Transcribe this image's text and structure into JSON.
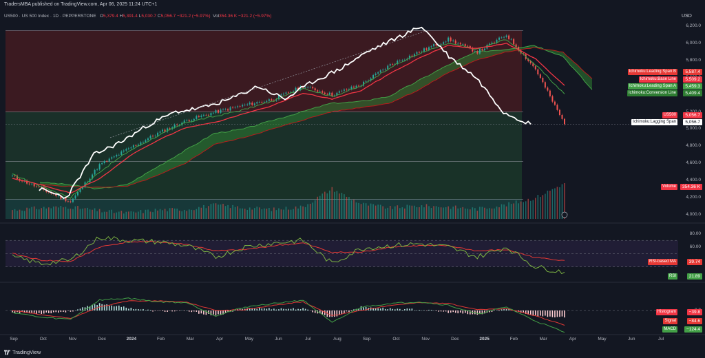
{
  "header": {
    "published": "TradersMBA published on TradingView.com, Apr 06, 2025 11:24 UTC+1",
    "currency": "USD",
    "symbol": "US500 · US 500 Index · 1D · PEPPERSTONE",
    "open_label": "O",
    "open": "5,379.4",
    "high_label": "H",
    "high": "5,391.4",
    "low_label": "L",
    "low": "5,030.7",
    "close_label": "C",
    "close": "5,056.7",
    "change": "−321.2 (−5.97%)",
    "vol_label": "Vol",
    "vol": "354.36 K",
    "vol_change": "−321.2 (−5.97%)"
  },
  "colors": {
    "background": "#131722",
    "up": "#26a69a",
    "down": "#ef5350",
    "lagging": "#ffffff",
    "base": "#f23645",
    "conversion": "#43a047",
    "rsi": "#7cb342",
    "rsi_ma": "#e53935"
  },
  "price_axis": [
    "6,200.0",
    "6,000.0",
    "5,800.0",
    "5,600.0",
    "5,400.0",
    "5,200.0",
    "5,000.0",
    "4,800.0",
    "4,600.0",
    "4,400.0",
    "4,200.0",
    "4,000.0"
  ],
  "rsi_axis": [
    "80.00",
    "60.00"
  ],
  "macd_axis": [
    "0.0"
  ],
  "time_axis": [
    {
      "label": "Sep",
      "bold": false
    },
    {
      "label": "Oct",
      "bold": false
    },
    {
      "label": "Nov",
      "bold": false
    },
    {
      "label": "Dec",
      "bold": false
    },
    {
      "label": "2024",
      "bold": true
    },
    {
      "label": "Feb",
      "bold": false
    },
    {
      "label": "Mar",
      "bold": false
    },
    {
      "label": "Apr",
      "bold": false
    },
    {
      "label": "May",
      "bold": false
    },
    {
      "label": "Jun",
      "bold": false
    },
    {
      "label": "Jul",
      "bold": false
    },
    {
      "label": "Aug",
      "bold": false
    },
    {
      "label": "Sep",
      "bold": false
    },
    {
      "label": "Oct",
      "bold": false
    },
    {
      "label": "Nov",
      "bold": false
    },
    {
      "label": "Dec",
      "bold": false
    },
    {
      "label": "2025",
      "bold": true
    },
    {
      "label": "Feb",
      "bold": false
    },
    {
      "label": "Mar",
      "bold": false
    },
    {
      "label": "Apr",
      "bold": false
    },
    {
      "label": "May",
      "bold": false
    },
    {
      "label": "Jun",
      "bold": false
    },
    {
      "label": "Jul",
      "bold": false
    }
  ],
  "tags": {
    "span_b": {
      "name": "Ichimoku:Leading Span B",
      "value": "5,587.4"
    },
    "base": {
      "name": "Ichimoku:Base Line",
      "value": "5,509.2"
    },
    "span_a": {
      "name": "Ichimoku:Leading Span A",
      "value": "5,459.3"
    },
    "conversion": {
      "name": "Ichimoku:Conversion Line",
      "value": "5,409.4"
    },
    "symbol": {
      "name": "US500",
      "value": "5,056.7"
    },
    "lagging": {
      "name": "Ichimoku:Lagging Span",
      "value": "5,056.7"
    },
    "volume": {
      "name": "Volume",
      "value": "354.36 K"
    },
    "rsi_ma": {
      "name": "RSI-based MA",
      "value": "39.74"
    },
    "rsi": {
      "name": "RSI",
      "value": "21.89"
    },
    "histogram": {
      "name": "Histogram",
      "value": "−39.8"
    },
    "signal": {
      "name": "Signal",
      "value": "−84.6"
    },
    "macd": {
      "name": "MACD",
      "value": "−124.4"
    }
  },
  "footer": {
    "brand": "TradingView"
  },
  "chart_data": [
    {
      "type": "line",
      "title": "US500 · US 500 Index · 1D · PEPPERSTONE",
      "xlabel": "",
      "ylabel": "USD",
      "ylim": [
        3950,
        6250
      ],
      "x": [
        "Sep",
        "Oct",
        "Nov",
        "Dec",
        "2024",
        "Feb",
        "Mar",
        "Apr",
        "May",
        "Jun",
        "Jul",
        "Aug",
        "Sep",
        "Oct",
        "Nov",
        "Dec",
        "2025",
        "Feb",
        "Mar",
        "Apr"
      ],
      "series": [
        {
          "name": "US500",
          "values": [
            4450,
            4300,
            4150,
            4580,
            4770,
            4950,
            5100,
            5200,
            5280,
            5350,
            5500,
            5400,
            5520,
            5750,
            5900,
            6050,
            5900,
            6100,
            5700,
            5056.7
          ]
        },
        {
          "name": "Ichimoku:Conversion Line",
          "values": [
            4470,
            4330,
            4200,
            4500,
            4740,
            4920,
            5080,
            5150,
            5230,
            5330,
            5480,
            5380,
            5500,
            5720,
            5880,
            6000,
            5930,
            6050,
            5750,
            5409.4
          ]
        },
        {
          "name": "Ichimoku:Base Line",
          "values": [
            4420,
            4350,
            4250,
            4420,
            4680,
            4870,
            5020,
            5080,
            5180,
            5280,
            5420,
            5350,
            5450,
            5650,
            5830,
            5980,
            5940,
            6000,
            5820,
            5509.2
          ]
        },
        {
          "name": "Ichimoku:Leading Span A",
          "values": [
            4380,
            4350,
            4300,
            4350,
            4550,
            4750,
            4950,
            5000,
            5100,
            5200,
            5300,
            5320,
            5380,
            5560,
            5740,
            5900,
            5930,
            5980,
            5850,
            5459.3
          ]
        },
        {
          "name": "Ichimoku:Leading Span B",
          "values": [
            4350,
            4330,
            4320,
            4330,
            4450,
            4600,
            4820,
            4900,
            5000,
            5100,
            5200,
            5250,
            5300,
            5450,
            5650,
            5800,
            5900,
            5950,
            5900,
            5587.4
          ]
        },
        {
          "name": "Ichimoku:Lagging Span",
          "values": [
            4300,
            4200,
            4700,
            4850,
            5050,
            5200,
            5250,
            5350,
            5500,
            5350,
            5550,
            5700,
            5900,
            6050,
            6200,
            5850,
            5600,
            5200,
            5056.7
          ]
        }
      ]
    },
    {
      "type": "bar",
      "title": "Volume",
      "categories": [
        "Sep",
        "Oct",
        "Nov",
        "Dec",
        "2024",
        "Feb",
        "Mar",
        "Apr",
        "May",
        "Jun",
        "Jul",
        "Aug",
        "Sep",
        "Oct",
        "Nov",
        "Dec",
        "2025",
        "Feb",
        "Mar",
        "Apr"
      ],
      "values": [
        90,
        110,
        120,
        80,
        60,
        90,
        95,
        140,
        110,
        95,
        120,
        300,
        150,
        110,
        130,
        120,
        100,
        140,
        210,
        354.36
      ]
    },
    {
      "type": "line",
      "title": "RSI",
      "ylim": [
        15,
        90
      ],
      "x": [
        "Sep",
        "Oct",
        "Nov",
        "Dec",
        "2024",
        "Feb",
        "Mar",
        "Apr",
        "May",
        "Jun",
        "Jul",
        "Aug",
        "Sep",
        "Oct",
        "Nov",
        "Dec",
        "2025",
        "Feb",
        "Mar",
        "Apr"
      ],
      "series": [
        {
          "name": "RSI",
          "values": [
            45,
            35,
            40,
            75,
            70,
            68,
            62,
            45,
            60,
            66,
            70,
            35,
            58,
            62,
            65,
            60,
            45,
            60,
            30,
            21.89
          ]
        },
        {
          "name": "RSI-based MA",
          "values": [
            50,
            40,
            38,
            60,
            68,
            68,
            64,
            54,
            56,
            62,
            66,
            52,
            52,
            60,
            62,
            62,
            54,
            56,
            44,
            39.74
          ]
        }
      ]
    },
    {
      "type": "line",
      "title": "MACD",
      "x": [
        "Sep",
        "Oct",
        "Nov",
        "Dec",
        "2024",
        "Feb",
        "Mar",
        "Apr",
        "May",
        "Jun",
        "Jul",
        "Aug",
        "Sep",
        "Oct",
        "Nov",
        "Dec",
        "2025",
        "Feb",
        "Mar",
        "Apr"
      ],
      "series": [
        {
          "name": "MACD",
          "values": [
            -10,
            -40,
            -50,
            60,
            70,
            50,
            45,
            -30,
            20,
            40,
            60,
            -70,
            20,
            40,
            50,
            30,
            -20,
            20,
            -60,
            -124.4
          ]
        },
        {
          "name": "Signal",
          "values": [
            0,
            -25,
            -45,
            20,
            55,
            55,
            48,
            0,
            5,
            30,
            50,
            -30,
            0,
            30,
            45,
            40,
            5,
            10,
            -30,
            -84.6
          ]
        },
        {
          "name": "Histogram",
          "values": [
            -10,
            -15,
            -5,
            40,
            15,
            -5,
            -3,
            -30,
            15,
            10,
            10,
            -40,
            20,
            10,
            5,
            -10,
            -25,
            10,
            -30,
            -39.8
          ]
        }
      ]
    }
  ]
}
